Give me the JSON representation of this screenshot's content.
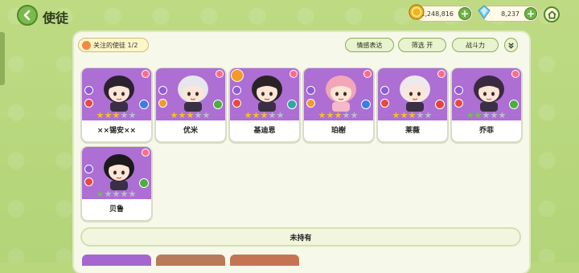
{
  "header": {
    "title": "使徒"
  },
  "resources": {
    "gold": {
      "icon": "gold-coin-icon",
      "value": "1,248,816"
    },
    "gem": {
      "icon": "crystal-gem-icon",
      "value": "8,237"
    }
  },
  "toolbar": {
    "followed_label": "关注的使徒",
    "followed_count": "1/2",
    "emotion_label": "情感表达",
    "filter_label": "筛选 开",
    "power_label": "战斗力"
  },
  "cards": [
    {
      "name": "××锡安××",
      "stars": 3,
      "star_color": "gold",
      "element_icon": "sword-icon",
      "arrow_icon": "blue-arrow-icon"
    },
    {
      "name": "优米",
      "stars": 3,
      "star_color": "gold",
      "element_icon": "cross-icon",
      "arrow_icon": "green-arrow-icon"
    },
    {
      "name": "基迪恩",
      "stars": 3,
      "star_color": "gold",
      "element_icon": "sword-icon",
      "arrow_icon": "teal-arrow-icon",
      "favorite": true
    },
    {
      "name": "珀榭",
      "stars": 3,
      "star_color": "gold",
      "element_icon": "cross-icon",
      "arrow_icon": "blue-arrow-icon"
    },
    {
      "name": "莱薇",
      "stars": 3,
      "star_color": "gold",
      "element_icon": "sword-icon",
      "arrow_icon": "red-arrow-icon"
    },
    {
      "name": "乔菲",
      "stars": 2,
      "star_color": "green",
      "element_icon": "sword-icon",
      "arrow_icon": "green-arrow-icon"
    },
    {
      "name": "贝鲁",
      "stars": 1,
      "star_color": "green",
      "element_icon": "sword-icon",
      "arrow_icon": "green-arrow-icon"
    }
  ],
  "sections": {
    "unowned_label": "未持有"
  },
  "colors": {
    "card_bg": "#ad6fd3",
    "accent": "#7cb84b",
    "star_gold": "#f4c21c",
    "star_green": "#6cc34e"
  }
}
